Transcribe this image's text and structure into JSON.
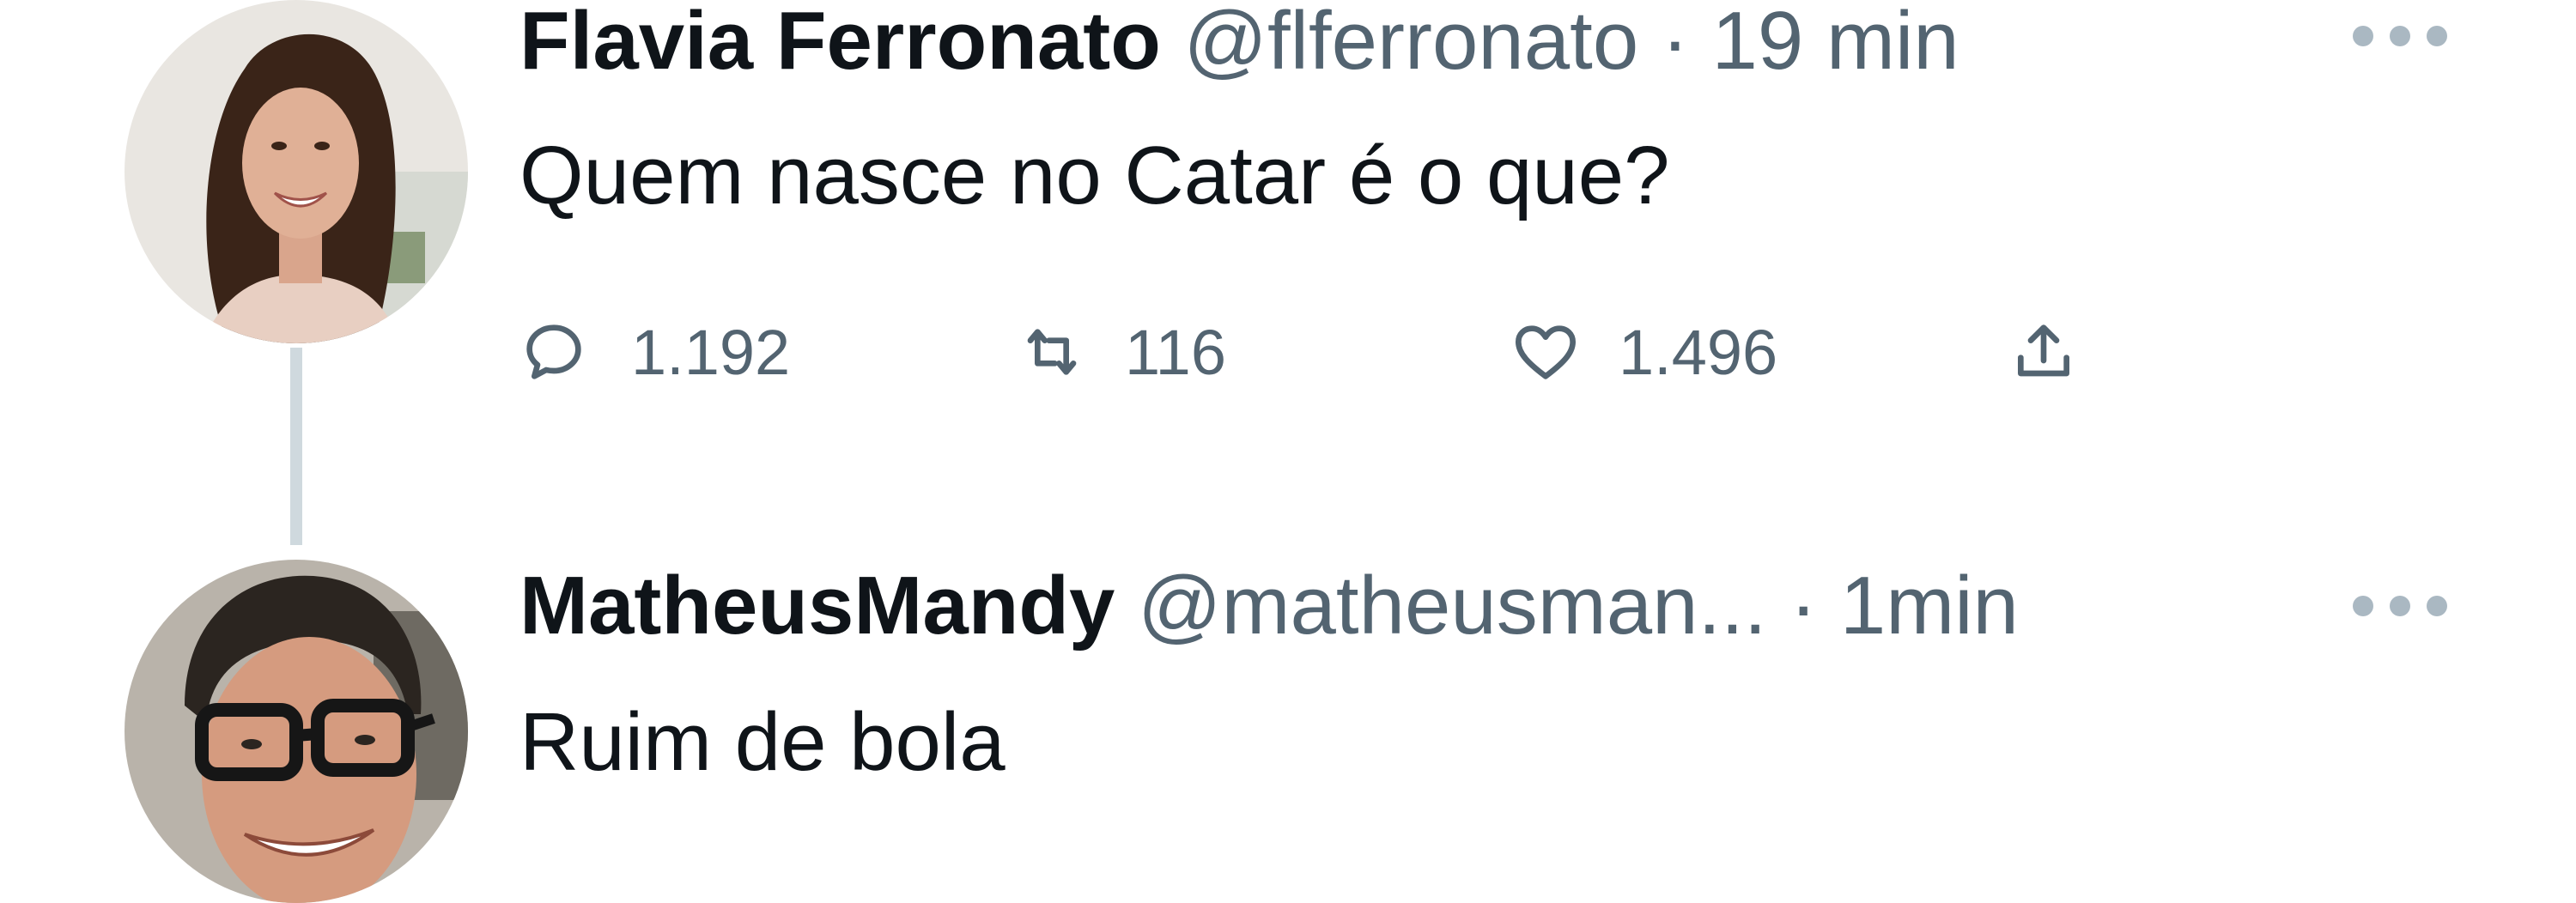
{
  "tweets": [
    {
      "name": "Flavia Ferronato",
      "handle": "@flferronato",
      "separator": "·",
      "time": "19 min",
      "text": "Quem nasce no Catar é o que?",
      "actions": {
        "replies": "1.192",
        "retweets": "116",
        "likes": "1.496"
      }
    },
    {
      "name": "MatheusMandy",
      "handle": "@matheusman...",
      "separator": "·",
      "time": "1min",
      "text": "Ruim de bola"
    }
  ],
  "colors": {
    "text_primary": "#0f1419",
    "text_secondary": "#536471",
    "thread_line": "#cfd9de",
    "more_dots": "#aab8c2"
  },
  "icons": {
    "reply": "speech-bubble-icon",
    "retweet": "retweet-arrows-icon",
    "like": "heart-icon",
    "share": "share-upload-icon",
    "more": "ellipsis-icon"
  }
}
